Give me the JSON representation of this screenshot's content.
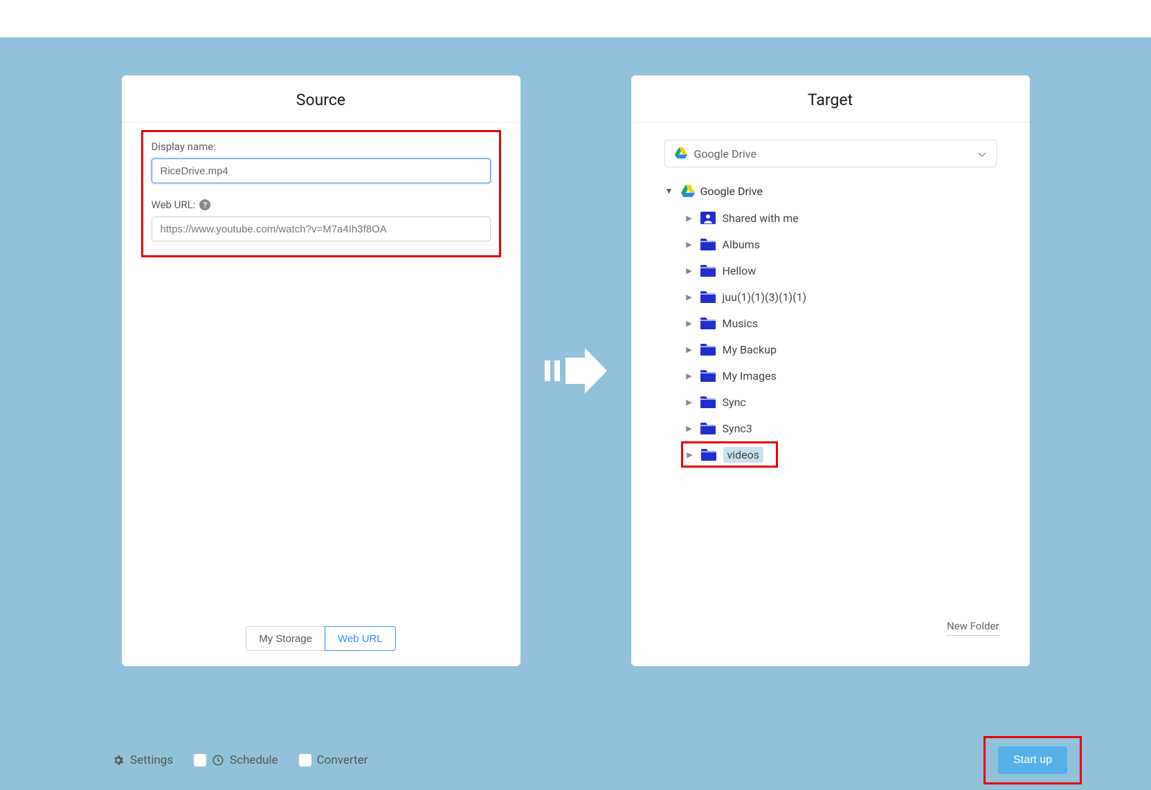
{
  "source": {
    "title": "Source",
    "display_name_label": "Display name:",
    "display_name_value": "RiceDrive.mp4",
    "web_url_label": "Web URL:",
    "web_url_value": "https://www.youtube.com/watch?v=M7a4Ih3f8OA",
    "tabs": {
      "my_storage": "My Storage",
      "web_url": "Web URL"
    }
  },
  "target": {
    "title": "Target",
    "selector_label": "Google Drive",
    "root_label": "Google Drive",
    "folders": [
      {
        "label": "Shared with me",
        "icon": "shared"
      },
      {
        "label": "Albums",
        "icon": "folder"
      },
      {
        "label": "Hellow",
        "icon": "folder"
      },
      {
        "label": "juu(1)(1)(3)(1)(1)",
        "icon": "folder"
      },
      {
        "label": "Musics",
        "icon": "folder"
      },
      {
        "label": "My Backup",
        "icon": "folder"
      },
      {
        "label": "My Images",
        "icon": "folder"
      },
      {
        "label": "Sync",
        "icon": "folder"
      },
      {
        "label": "Sync3",
        "icon": "folder"
      },
      {
        "label": "videos",
        "icon": "folder",
        "selected": true
      }
    ],
    "new_folder": "New Folder"
  },
  "footer": {
    "settings": "Settings",
    "schedule": "Schedule",
    "converter": "Converter",
    "start": "Start up"
  }
}
